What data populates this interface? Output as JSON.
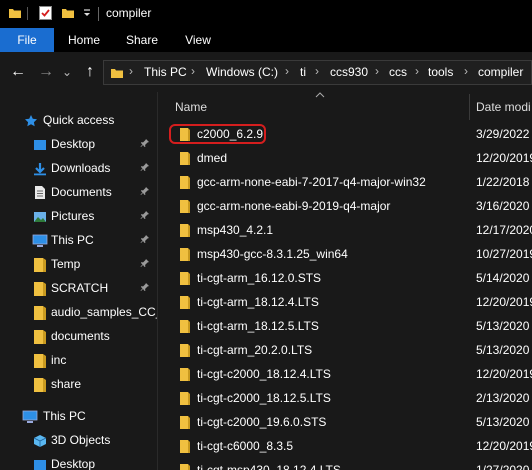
{
  "window": {
    "title": "compiler"
  },
  "ribbon": {
    "tabs": [
      "File",
      "Home",
      "Share",
      "View"
    ]
  },
  "nav": {
    "back_glyph": "←",
    "forward_glyph": "→",
    "dropdown_glyph": "⌄",
    "up_glyph": "↑",
    "sep_glyph": "›",
    "breadcrumbs": [
      "This PC",
      "Windows (C:)",
      "ti",
      "ccs930",
      "ccs",
      "tools",
      "compiler"
    ]
  },
  "sidebar": {
    "quick_access": "Quick access",
    "items": [
      {
        "label": "Desktop",
        "icon": "desktop-icon",
        "pinned": true
      },
      {
        "label": "Downloads",
        "icon": "downloads-icon",
        "pinned": true
      },
      {
        "label": "Documents",
        "icon": "documents-icon",
        "pinned": true
      },
      {
        "label": "Pictures",
        "icon": "pictures-icon",
        "pinned": true
      },
      {
        "label": "This PC",
        "icon": "this-pc-icon",
        "pinned": true
      },
      {
        "label": "Temp",
        "icon": "folder-icon",
        "pinned": true
      },
      {
        "label": "SCRATCH",
        "icon": "folder-icon",
        "pinned": true
      },
      {
        "label": "audio_samples_CC_",
        "icon": "folder-icon",
        "pinned": false
      },
      {
        "label": "documents",
        "icon": "folder-icon",
        "pinned": false
      },
      {
        "label": "inc",
        "icon": "folder-icon",
        "pinned": false
      },
      {
        "label": "share",
        "icon": "folder-icon",
        "pinned": false
      }
    ],
    "this_pc": "This PC",
    "this_pc_items": [
      {
        "label": "3D Objects",
        "icon": "3d-objects-icon"
      },
      {
        "label": "Desktop",
        "icon": "desktop-icon"
      }
    ],
    "pin_glyph": "📌"
  },
  "columns": {
    "name": "Name",
    "date": "Date modi"
  },
  "files": [
    {
      "name": "c2000_6.2.9",
      "date": "3/29/2022",
      "highlighted": true
    },
    {
      "name": "dmed",
      "date": "12/20/2019"
    },
    {
      "name": "gcc-arm-none-eabi-7-2017-q4-major-win32",
      "date": "1/22/2018"
    },
    {
      "name": "gcc-arm-none-eabi-9-2019-q4-major",
      "date": "3/16/2020"
    },
    {
      "name": "msp430_4.2.1",
      "date": "12/17/2020"
    },
    {
      "name": "msp430-gcc-8.3.1.25_win64",
      "date": "10/27/2019"
    },
    {
      "name": "ti-cgt-arm_16.12.0.STS",
      "date": "5/14/2020"
    },
    {
      "name": "ti-cgt-arm_18.12.4.LTS",
      "date": "12/20/2019"
    },
    {
      "name": "ti-cgt-arm_18.12.5.LTS",
      "date": "5/13/2020"
    },
    {
      "name": "ti-cgt-arm_20.2.0.LTS",
      "date": "5/13/2020"
    },
    {
      "name": "ti-cgt-c2000_18.12.4.LTS",
      "date": "12/20/2019"
    },
    {
      "name": "ti-cgt-c2000_18.12.5.LTS",
      "date": "2/13/2020"
    },
    {
      "name": "ti-cgt-c2000_19.6.0.STS",
      "date": "5/13/2020"
    },
    {
      "name": "ti-cgt-c6000_8.3.5",
      "date": "12/20/2019"
    },
    {
      "name": "ti-cgt-msp430_18.12.4.LTS",
      "date": "1/27/2020"
    }
  ],
  "colors": {
    "folder": "#f0c040",
    "accent": "#1a6dd0",
    "highlight": "#d51e1e"
  }
}
